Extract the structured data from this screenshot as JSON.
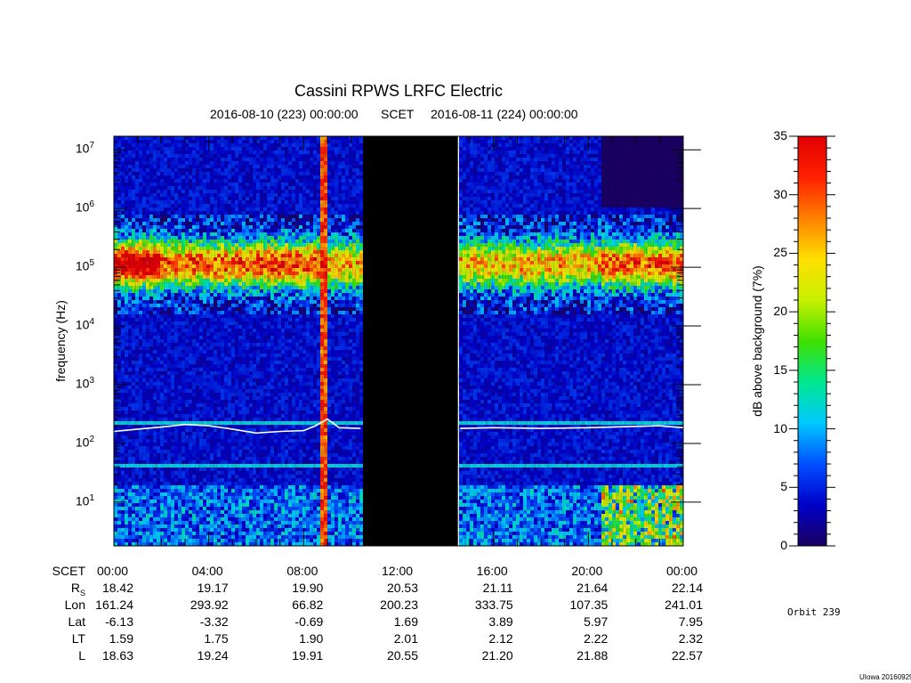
{
  "chart_data": {
    "type": "heatmap",
    "title": "Cassini RPWS LRFC Electric",
    "subtitle": {
      "left": "2016-08-10 (223) 00:00:00",
      "center": "SCET",
      "right": "2016-08-11 (224) 00:00:00"
    },
    "ylabel": "frequency (Hz)",
    "yscale": "log",
    "ylim_hz": [
      1.8,
      17000000
    ],
    "y_ticks": [
      {
        "base": "10",
        "exp": "7"
      },
      {
        "base": "10",
        "exp": "6"
      },
      {
        "base": "10",
        "exp": "5"
      },
      {
        "base": "10",
        "exp": "4"
      },
      {
        "base": "10",
        "exp": "3"
      },
      {
        "base": "10",
        "exp": "2"
      },
      {
        "base": "10",
        "exp": "1"
      }
    ],
    "x_range_hours": [
      0,
      24
    ],
    "data_gap_hours": [
      10.5,
      14.5
    ],
    "colorbar": {
      "label": "dB above background (7%)",
      "range": [
        0,
        35
      ],
      "ticks": [
        "35",
        "30",
        "25",
        "20",
        "15",
        "10",
        "5",
        "0"
      ],
      "colors": [
        "#1a0060",
        "#0000c8",
        "#0050ff",
        "#00c8ff",
        "#00e890",
        "#40e000",
        "#c8f000",
        "#ffe000",
        "#ff8000",
        "#ff2000",
        "#e00000"
      ]
    },
    "cyclotron_line_hz": [
      [
        0,
        160
      ],
      [
        1,
        175
      ],
      [
        2,
        190
      ],
      [
        3,
        210
      ],
      [
        4,
        200
      ],
      [
        5,
        175
      ],
      [
        6,
        150
      ],
      [
        7,
        160
      ],
      [
        8,
        165
      ],
      [
        8.5,
        200
      ],
      [
        9,
        260
      ],
      [
        9.5,
        185
      ],
      [
        10.4,
        180
      ],
      [
        14.6,
        180
      ],
      [
        16,
        185
      ],
      [
        18,
        180
      ],
      [
        20,
        185
      ],
      [
        21,
        190
      ],
      [
        22,
        195
      ],
      [
        23,
        200
      ],
      [
        24,
        185
      ]
    ],
    "ephemeris": {
      "time_label": "SCET",
      "times": [
        "00:00",
        "04:00",
        "08:00",
        "12:00",
        "16:00",
        "20:00",
        "00:00"
      ],
      "rows": [
        {
          "label": "R",
          "sub": "S",
          "values": [
            "18.42",
            "19.17",
            "19.90",
            "20.53",
            "21.11",
            "21.64",
            "22.14"
          ]
        },
        {
          "label": "Lon",
          "sub": "",
          "values": [
            "161.24",
            "293.92",
            "66.82",
            "200.23",
            "333.75",
            "107.35",
            "241.01"
          ]
        },
        {
          "label": "Lat",
          "sub": "",
          "values": [
            "-6.13",
            "-3.32",
            "-0.69",
            "1.69",
            "3.89",
            "5.97",
            "7.95"
          ]
        },
        {
          "label": "LT",
          "sub": "",
          "values": [
            "1.59",
            "1.75",
            "1.90",
            "2.01",
            "2.12",
            "2.22",
            "2.32"
          ]
        },
        {
          "label": "L",
          "sub": "",
          "values": [
            "18.63",
            "19.24",
            "19.91",
            "20.55",
            "21.20",
            "21.88",
            "22.57"
          ]
        }
      ]
    }
  },
  "orbit": "Orbit 239",
  "credit": "UIowa 20160929"
}
